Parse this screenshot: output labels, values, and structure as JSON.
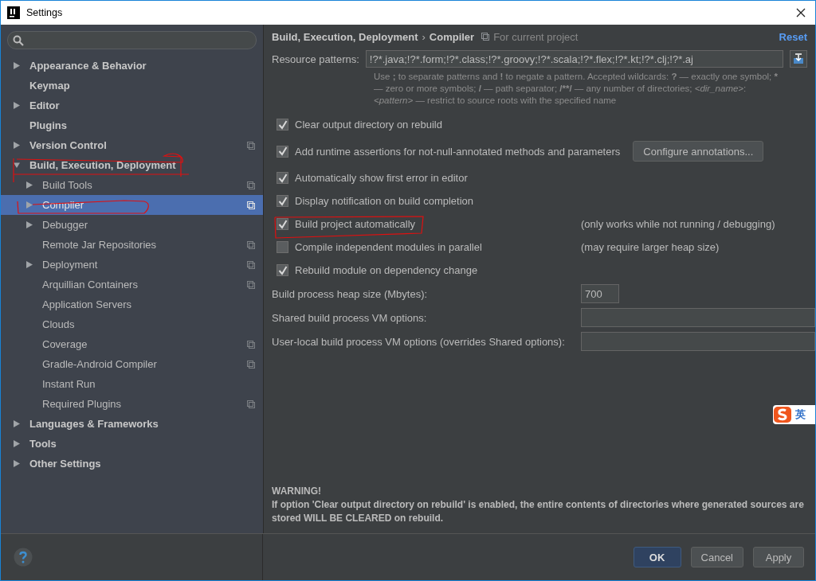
{
  "window": {
    "title": "Settings"
  },
  "sidebar": {
    "items": [
      {
        "label": "Appearance & Behavior",
        "expandable": true,
        "expanded": false,
        "selected": false,
        "project_level": false
      },
      {
        "label": "Keymap",
        "expandable": false,
        "selected": false,
        "project_level": false
      },
      {
        "label": "Editor",
        "expandable": true,
        "expanded": false,
        "selected": false,
        "project_level": false
      },
      {
        "label": "Plugins",
        "expandable": false,
        "selected": false,
        "project_level": false
      },
      {
        "label": "Version Control",
        "expandable": true,
        "expanded": false,
        "selected": false,
        "project_level": true
      },
      {
        "label": "Build, Execution, Deployment",
        "expandable": true,
        "expanded": true,
        "selected": false,
        "project_level": false,
        "children": [
          {
            "label": "Build Tools",
            "expandable": true,
            "expanded": false,
            "selected": false,
            "project_level": true
          },
          {
            "label": "Compiler",
            "expandable": true,
            "expanded": false,
            "selected": true,
            "project_level": true
          },
          {
            "label": "Debugger",
            "expandable": true,
            "expanded": false,
            "selected": false,
            "project_level": false
          },
          {
            "label": "Remote Jar Repositories",
            "expandable": false,
            "selected": false,
            "project_level": true
          },
          {
            "label": "Deployment",
            "expandable": true,
            "expanded": false,
            "selected": false,
            "project_level": true
          },
          {
            "label": "Arquillian Containers",
            "expandable": false,
            "selected": false,
            "project_level": true
          },
          {
            "label": "Application Servers",
            "expandable": false,
            "selected": false,
            "project_level": false
          },
          {
            "label": "Clouds",
            "expandable": false,
            "selected": false,
            "project_level": false
          },
          {
            "label": "Coverage",
            "expandable": false,
            "selected": false,
            "project_level": true
          },
          {
            "label": "Gradle-Android Compiler",
            "expandable": false,
            "selected": false,
            "project_level": true
          },
          {
            "label": "Instant Run",
            "expandable": false,
            "selected": false,
            "project_level": false
          },
          {
            "label": "Required Plugins",
            "expandable": false,
            "selected": false,
            "project_level": true
          }
        ]
      },
      {
        "label": "Languages & Frameworks",
        "expandable": true,
        "expanded": false,
        "selected": false,
        "project_level": false
      },
      {
        "label": "Tools",
        "expandable": true,
        "expanded": false,
        "selected": false,
        "project_level": false
      },
      {
        "label": "Other Settings",
        "expandable": true,
        "expanded": false,
        "selected": false,
        "project_level": false
      }
    ]
  },
  "breadcrumb": {
    "parent": "Build, Execution, Deployment",
    "separator": "›",
    "current": "Compiler",
    "scope": "For current project"
  },
  "reset_link": "Reset",
  "resource_patterns": {
    "label": "Resource patterns:",
    "value": "!?*.java;!?*.form;!?*.class;!?*.groovy;!?*.scala;!?*.flex;!?*.kt;!?*.clj;!?*.aj",
    "hint": [
      {
        "text": "Use ",
        "kind": "text"
      },
      {
        "text": ";",
        "kind": "symbol"
      },
      {
        "text": " to separate patterns and ",
        "kind": "text"
      },
      {
        "text": "!",
        "kind": "symbol"
      },
      {
        "text": " to negate a pattern. Accepted wildcards: ",
        "kind": "text"
      },
      {
        "text": "?",
        "kind": "symbol"
      },
      {
        "text": " — exactly one symbol; ",
        "kind": "text"
      },
      {
        "text": "*",
        "kind": "symbol"
      },
      {
        "text": " — zero or more symbols; ",
        "kind": "text"
      },
      {
        "text": "/",
        "kind": "symbol"
      },
      {
        "text": " — path separator; ",
        "kind": "text"
      },
      {
        "text": "/**/",
        "kind": "symbol"
      },
      {
        "text": " — any number of directories; ",
        "kind": "text"
      },
      {
        "text": "<dir_name>",
        "kind": "placeholder"
      },
      {
        "text": ":",
        "kind": "text"
      },
      {
        "text": "<pattern>",
        "kind": "placeholder"
      },
      {
        "text": " — restrict to source roots with the specified name",
        "kind": "text"
      }
    ]
  },
  "options": [
    {
      "label": "Clear output directory on rebuild",
      "checked": true
    },
    {
      "label": "Add runtime assertions for not-null-annotated methods and parameters",
      "checked": true,
      "button": "Configure annotations..."
    },
    {
      "label": "Automatically show first error in editor",
      "checked": true
    },
    {
      "label": "Display notification on build completion",
      "checked": true
    },
    {
      "label": "Build project automatically",
      "checked": true,
      "note": "(only works while not running / debugging)"
    },
    {
      "label": "Compile independent modules in parallel",
      "checked": false,
      "note": "(may require larger heap size)"
    },
    {
      "label": "Rebuild module on dependency change",
      "checked": true
    }
  ],
  "fields": [
    {
      "label": "Build process heap size (Mbytes):",
      "value": "700",
      "kind": "short"
    },
    {
      "label": "Shared build process VM options:",
      "kind": "wide"
    },
    {
      "label": "User-local build process VM options (overrides Shared options):",
      "kind": "wide"
    }
  ],
  "warning": {
    "title": "WARNING!",
    "text": "If option 'Clear output directory on rebuild' is enabled, the entire contents of directories where generated sources are stored WILL BE CLEARED on rebuild."
  },
  "ime_widget": {
    "label": "英"
  },
  "buttons": [
    {
      "label": "OK",
      "kind": "default"
    },
    {
      "label": "Cancel",
      "kind": "normal"
    },
    {
      "label": "Apply",
      "kind": "normal"
    }
  ]
}
